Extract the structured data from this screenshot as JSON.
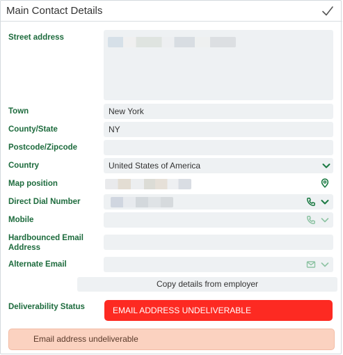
{
  "header": {
    "title": "Main Contact Details"
  },
  "fields": {
    "street_address": {
      "label": "Street address"
    },
    "town": {
      "label": "Town",
      "value": "New York"
    },
    "county_state": {
      "label": "County/State",
      "value": "NY"
    },
    "postcode": {
      "label": "Postcode/Zipcode",
      "value": ""
    },
    "country": {
      "label": "Country",
      "value": "United States of America"
    },
    "map_position": {
      "label": "Map position"
    },
    "direct_dial": {
      "label": "Direct Dial Number"
    },
    "mobile": {
      "label": "Mobile",
      "value": ""
    },
    "hardbounced_email": {
      "label": "Hardbounced Email Address",
      "value": ""
    },
    "alternate_email": {
      "label": "Alternate Email",
      "value": ""
    }
  },
  "copy_button": {
    "label": "Copy details from employer"
  },
  "deliverability": {
    "label": "Deliverability Status",
    "status": "EMAIL ADDRESS UNDELIVERABLE",
    "banner": "Email address undeliverable"
  },
  "colors": {
    "label_green": "#1d6b3d",
    "icon_green": "#1b7a43",
    "icon_muted": "#8dc3a3",
    "status_red": "#fd2a22",
    "banner_bg": "#fbd2c0",
    "field_bg": "#eef1f3"
  },
  "icons": [
    "check-icon",
    "chevron-down-icon",
    "map-pin-icon",
    "phone-icon",
    "envelope-icon"
  ]
}
